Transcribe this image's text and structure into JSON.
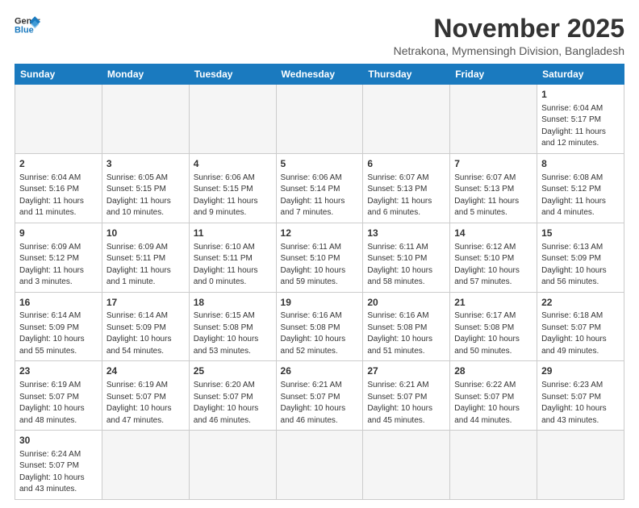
{
  "logo": {
    "line1": "General",
    "line2": "Blue"
  },
  "title": "November 2025",
  "subtitle": "Netrakona, Mymensingh Division, Bangladesh",
  "days_of_week": [
    "Sunday",
    "Monday",
    "Tuesday",
    "Wednesday",
    "Thursday",
    "Friday",
    "Saturday"
  ],
  "weeks": [
    [
      {
        "day": "",
        "info": ""
      },
      {
        "day": "",
        "info": ""
      },
      {
        "day": "",
        "info": ""
      },
      {
        "day": "",
        "info": ""
      },
      {
        "day": "",
        "info": ""
      },
      {
        "day": "",
        "info": ""
      },
      {
        "day": "1",
        "info": "Sunrise: 6:04 AM\nSunset: 5:17 PM\nDaylight: 11 hours\nand 12 minutes."
      }
    ],
    [
      {
        "day": "2",
        "info": "Sunrise: 6:04 AM\nSunset: 5:16 PM\nDaylight: 11 hours\nand 11 minutes."
      },
      {
        "day": "3",
        "info": "Sunrise: 6:05 AM\nSunset: 5:15 PM\nDaylight: 11 hours\nand 10 minutes."
      },
      {
        "day": "4",
        "info": "Sunrise: 6:06 AM\nSunset: 5:15 PM\nDaylight: 11 hours\nand 9 minutes."
      },
      {
        "day": "5",
        "info": "Sunrise: 6:06 AM\nSunset: 5:14 PM\nDaylight: 11 hours\nand 7 minutes."
      },
      {
        "day": "6",
        "info": "Sunrise: 6:07 AM\nSunset: 5:13 PM\nDaylight: 11 hours\nand 6 minutes."
      },
      {
        "day": "7",
        "info": "Sunrise: 6:07 AM\nSunset: 5:13 PM\nDaylight: 11 hours\nand 5 minutes."
      },
      {
        "day": "8",
        "info": "Sunrise: 6:08 AM\nSunset: 5:12 PM\nDaylight: 11 hours\nand 4 minutes."
      }
    ],
    [
      {
        "day": "9",
        "info": "Sunrise: 6:09 AM\nSunset: 5:12 PM\nDaylight: 11 hours\nand 3 minutes."
      },
      {
        "day": "10",
        "info": "Sunrise: 6:09 AM\nSunset: 5:11 PM\nDaylight: 11 hours\nand 1 minute."
      },
      {
        "day": "11",
        "info": "Sunrise: 6:10 AM\nSunset: 5:11 PM\nDaylight: 11 hours\nand 0 minutes."
      },
      {
        "day": "12",
        "info": "Sunrise: 6:11 AM\nSunset: 5:10 PM\nDaylight: 10 hours\nand 59 minutes."
      },
      {
        "day": "13",
        "info": "Sunrise: 6:11 AM\nSunset: 5:10 PM\nDaylight: 10 hours\nand 58 minutes."
      },
      {
        "day": "14",
        "info": "Sunrise: 6:12 AM\nSunset: 5:10 PM\nDaylight: 10 hours\nand 57 minutes."
      },
      {
        "day": "15",
        "info": "Sunrise: 6:13 AM\nSunset: 5:09 PM\nDaylight: 10 hours\nand 56 minutes."
      }
    ],
    [
      {
        "day": "16",
        "info": "Sunrise: 6:14 AM\nSunset: 5:09 PM\nDaylight: 10 hours\nand 55 minutes."
      },
      {
        "day": "17",
        "info": "Sunrise: 6:14 AM\nSunset: 5:09 PM\nDaylight: 10 hours\nand 54 minutes."
      },
      {
        "day": "18",
        "info": "Sunrise: 6:15 AM\nSunset: 5:08 PM\nDaylight: 10 hours\nand 53 minutes."
      },
      {
        "day": "19",
        "info": "Sunrise: 6:16 AM\nSunset: 5:08 PM\nDaylight: 10 hours\nand 52 minutes."
      },
      {
        "day": "20",
        "info": "Sunrise: 6:16 AM\nSunset: 5:08 PM\nDaylight: 10 hours\nand 51 minutes."
      },
      {
        "day": "21",
        "info": "Sunrise: 6:17 AM\nSunset: 5:08 PM\nDaylight: 10 hours\nand 50 minutes."
      },
      {
        "day": "22",
        "info": "Sunrise: 6:18 AM\nSunset: 5:07 PM\nDaylight: 10 hours\nand 49 minutes."
      }
    ],
    [
      {
        "day": "23",
        "info": "Sunrise: 6:19 AM\nSunset: 5:07 PM\nDaylight: 10 hours\nand 48 minutes."
      },
      {
        "day": "24",
        "info": "Sunrise: 6:19 AM\nSunset: 5:07 PM\nDaylight: 10 hours\nand 47 minutes."
      },
      {
        "day": "25",
        "info": "Sunrise: 6:20 AM\nSunset: 5:07 PM\nDaylight: 10 hours\nand 46 minutes."
      },
      {
        "day": "26",
        "info": "Sunrise: 6:21 AM\nSunset: 5:07 PM\nDaylight: 10 hours\nand 46 minutes."
      },
      {
        "day": "27",
        "info": "Sunrise: 6:21 AM\nSunset: 5:07 PM\nDaylight: 10 hours\nand 45 minutes."
      },
      {
        "day": "28",
        "info": "Sunrise: 6:22 AM\nSunset: 5:07 PM\nDaylight: 10 hours\nand 44 minutes."
      },
      {
        "day": "29",
        "info": "Sunrise: 6:23 AM\nSunset: 5:07 PM\nDaylight: 10 hours\nand 43 minutes."
      }
    ],
    [
      {
        "day": "30",
        "info": "Sunrise: 6:24 AM\nSunset: 5:07 PM\nDaylight: 10 hours\nand 43 minutes."
      },
      {
        "day": "",
        "info": ""
      },
      {
        "day": "",
        "info": ""
      },
      {
        "day": "",
        "info": ""
      },
      {
        "day": "",
        "info": ""
      },
      {
        "day": "",
        "info": ""
      },
      {
        "day": "",
        "info": ""
      }
    ]
  ],
  "colors": {
    "header_bg": "#1a7abf",
    "logo_blue": "#1a7abf"
  }
}
